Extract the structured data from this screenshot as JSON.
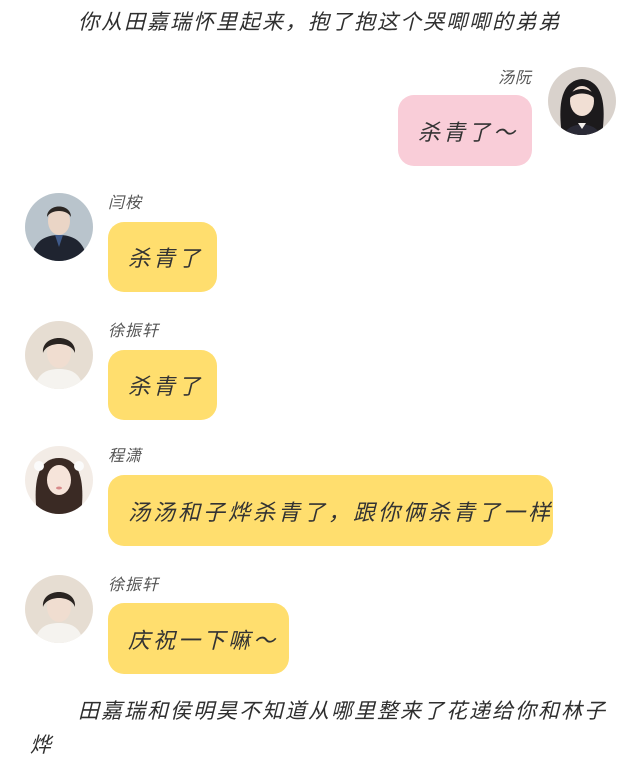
{
  "narration_top": "你从田嘉瑞怀里起来，抱了抱这个哭唧唧的弟弟",
  "narration_bottom": "田嘉瑞和侯明昊不知道从哪里整来了花递给你和林子烨",
  "messages": [
    {
      "sender": "汤阮",
      "text": "杀青了～",
      "side": "right",
      "bubble_color": "#f9cdd8"
    },
    {
      "sender": "闫桉",
      "text": "杀青了",
      "side": "left",
      "bubble_color": "#ffde6e"
    },
    {
      "sender": "徐振轩",
      "text": "杀青了",
      "side": "left",
      "bubble_color": "#ffde6e"
    },
    {
      "sender": "程潇",
      "text": "汤汤和子烨杀青了，跟你俩杀青了一样",
      "side": "left",
      "bubble_color": "#ffde6e"
    },
    {
      "sender": "徐振轩",
      "text": "庆祝一下嘛～",
      "side": "left",
      "bubble_color": "#ffde6e"
    }
  ]
}
